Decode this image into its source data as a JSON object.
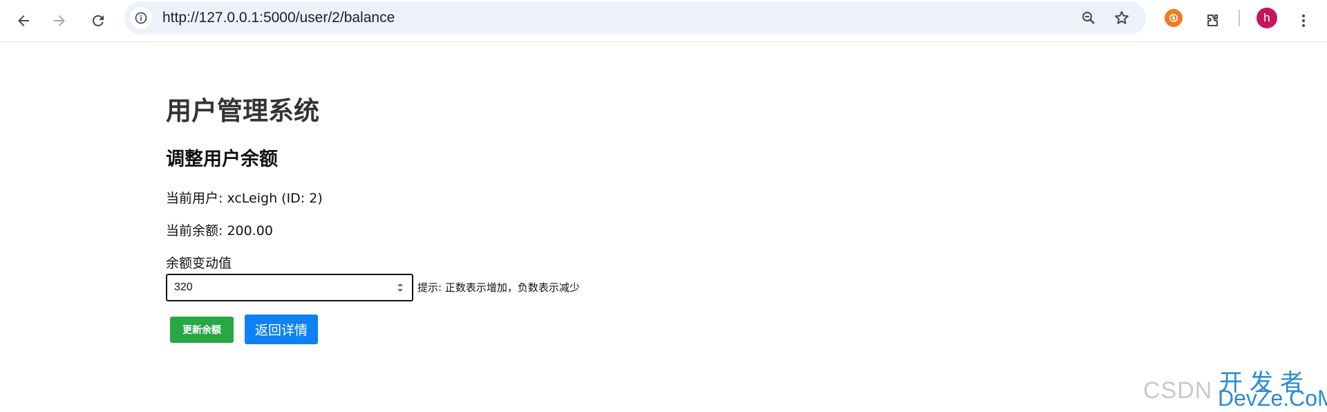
{
  "browser": {
    "url": "http://127.0.0.1:5000/user/2/balance",
    "profile_initial": "h",
    "icons": [
      "back-arrow-icon",
      "forward-arrow-icon",
      "reload-icon",
      "info-icon",
      "zoom-icon",
      "bookmark-star-icon",
      "extension-app-icon",
      "extensions-puzzle-icon",
      "kebab-menu-icon"
    ]
  },
  "page": {
    "app_title": "用户管理系统",
    "section_title": "调整用户余额",
    "current_user": "当前用户: xcLeigh (ID: 2)",
    "current_balance": "当前余额: 200.00",
    "field_label": "余额变动值",
    "field_value": "320",
    "hint": "提示: 正数表示增加，负数表示减少",
    "update_button": "更新余额",
    "back_button": "返回详情"
  },
  "watermark": {
    "csdn": "CSDN",
    "cn": "开发者",
    "en": "DevZe.CoM"
  },
  "colors": {
    "update_button": "#28a745",
    "back_button": "#0d82f5",
    "avatar": "#c2185b",
    "omnibox": "#edf2fa"
  }
}
